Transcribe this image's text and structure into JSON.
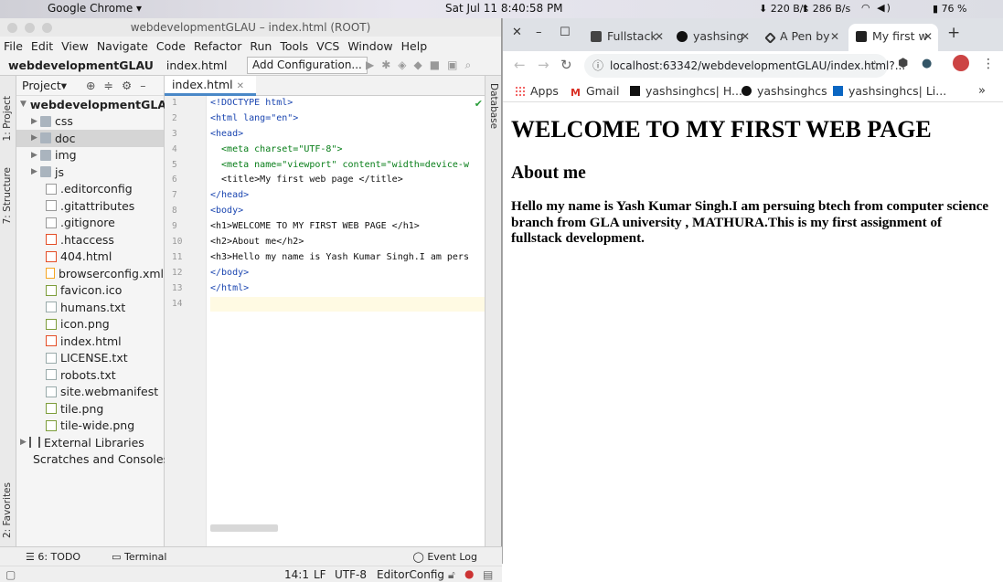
{
  "system_bar": {
    "app_name": "Google Chrome ▾",
    "clock": "Sat Jul 11   8:40:58 PM",
    "net_down": "220 B/s",
    "net_up": "286 B/s",
    "battery": "76 %"
  },
  "ide": {
    "window_title": "webdevelopmentGLAU – index.html (ROOT)",
    "menu": [
      "File",
      "Edit",
      "View",
      "Navigate",
      "Code",
      "Refactor",
      "Run",
      "Tools",
      "VCS",
      "Window",
      "Help"
    ],
    "breadcrumb_project": "webdevelopmentGLAU",
    "breadcrumb_file": "index.html",
    "add_configuration": "Add Configuration...",
    "left_tabs": {
      "project": "1: Project",
      "structure": "7: Structure",
      "favorites": "2: Favorites"
    },
    "right_tab": "Database",
    "project_pane_title": "Project▾",
    "tree": [
      {
        "label": "webdevelopmentGLAU",
        "kind": "root"
      },
      {
        "label": "css",
        "kind": "folder"
      },
      {
        "label": "doc",
        "kind": "folder"
      },
      {
        "label": "img",
        "kind": "folder"
      },
      {
        "label": "js",
        "kind": "folder"
      },
      {
        "label": ".editorconfig",
        "kind": "file"
      },
      {
        "label": ".gitattributes",
        "kind": "file"
      },
      {
        "label": ".gitignore",
        "kind": "file"
      },
      {
        "label": ".htaccess",
        "kind": "file"
      },
      {
        "label": "404.html",
        "kind": "file"
      },
      {
        "label": "browserconfig.xml",
        "kind": "file"
      },
      {
        "label": "favicon.ico",
        "kind": "file"
      },
      {
        "label": "humans.txt",
        "kind": "file"
      },
      {
        "label": "icon.png",
        "kind": "file"
      },
      {
        "label": "index.html",
        "kind": "file"
      },
      {
        "label": "LICENSE.txt",
        "kind": "file"
      },
      {
        "label": "robots.txt",
        "kind": "file"
      },
      {
        "label": "site.webmanifest",
        "kind": "file"
      },
      {
        "label": "tile.png",
        "kind": "file"
      },
      {
        "label": "tile-wide.png",
        "kind": "file"
      },
      {
        "label": "External Libraries",
        "kind": "lib"
      },
      {
        "label": "Scratches and Consoles",
        "kind": "scratch"
      }
    ],
    "editor_tab": "index.html",
    "line_numbers": [
      "1",
      "2",
      "3",
      "4",
      "5",
      "6",
      "7",
      "8",
      "9",
      "10",
      "11",
      "12",
      "13",
      "14"
    ],
    "code_lines": [
      "<!DOCTYPE html>",
      "<html lang=\"en\">",
      "<head>",
      "  <meta charset=\"UTF-8\">",
      "  <meta name=\"viewport\" content=\"width=device-w",
      "  <title>My first web page </title>",
      "</head>",
      "<body>",
      "<h1>WELCOME TO MY FIRST WEB PAGE </h1>",
      "<h2>About me</h2>",
      "<h3>Hello my name is Yash Kumar Singh.I am pers",
      "</body>",
      "</html>",
      ""
    ],
    "bottom_tools": {
      "todo": "6: TODO",
      "terminal": "Terminal",
      "event_log": "Event Log"
    },
    "status": {
      "position": "14:1",
      "line_sep": "LF",
      "encoding": "UTF-8",
      "config": "EditorConfig"
    }
  },
  "chrome": {
    "tabs": [
      {
        "title": "Fullstack",
        "color": "#444"
      },
      {
        "title": "yashsing",
        "color": "#111"
      },
      {
        "title": "A Pen by",
        "color": "#333"
      },
      {
        "title": "My first w",
        "color": "#222"
      }
    ],
    "url": "localhost:63342/webdevelopmentGLAU/index.html?...",
    "bookmarks": [
      {
        "label": "Apps"
      },
      {
        "label": "Gmail"
      },
      {
        "label": "yashsinghcs| H..."
      },
      {
        "label": "yashsinghcs"
      },
      {
        "label": "yashsinghcs| Li..."
      }
    ],
    "page": {
      "h1": "WELCOME TO MY FIRST WEB PAGE",
      "h2": "About me",
      "h3": "Hello my name is Yash Kumar Singh.I am persuing btech from computer science branch from GLA university , MATHURA.This is my first assignment of fullstack development."
    }
  }
}
